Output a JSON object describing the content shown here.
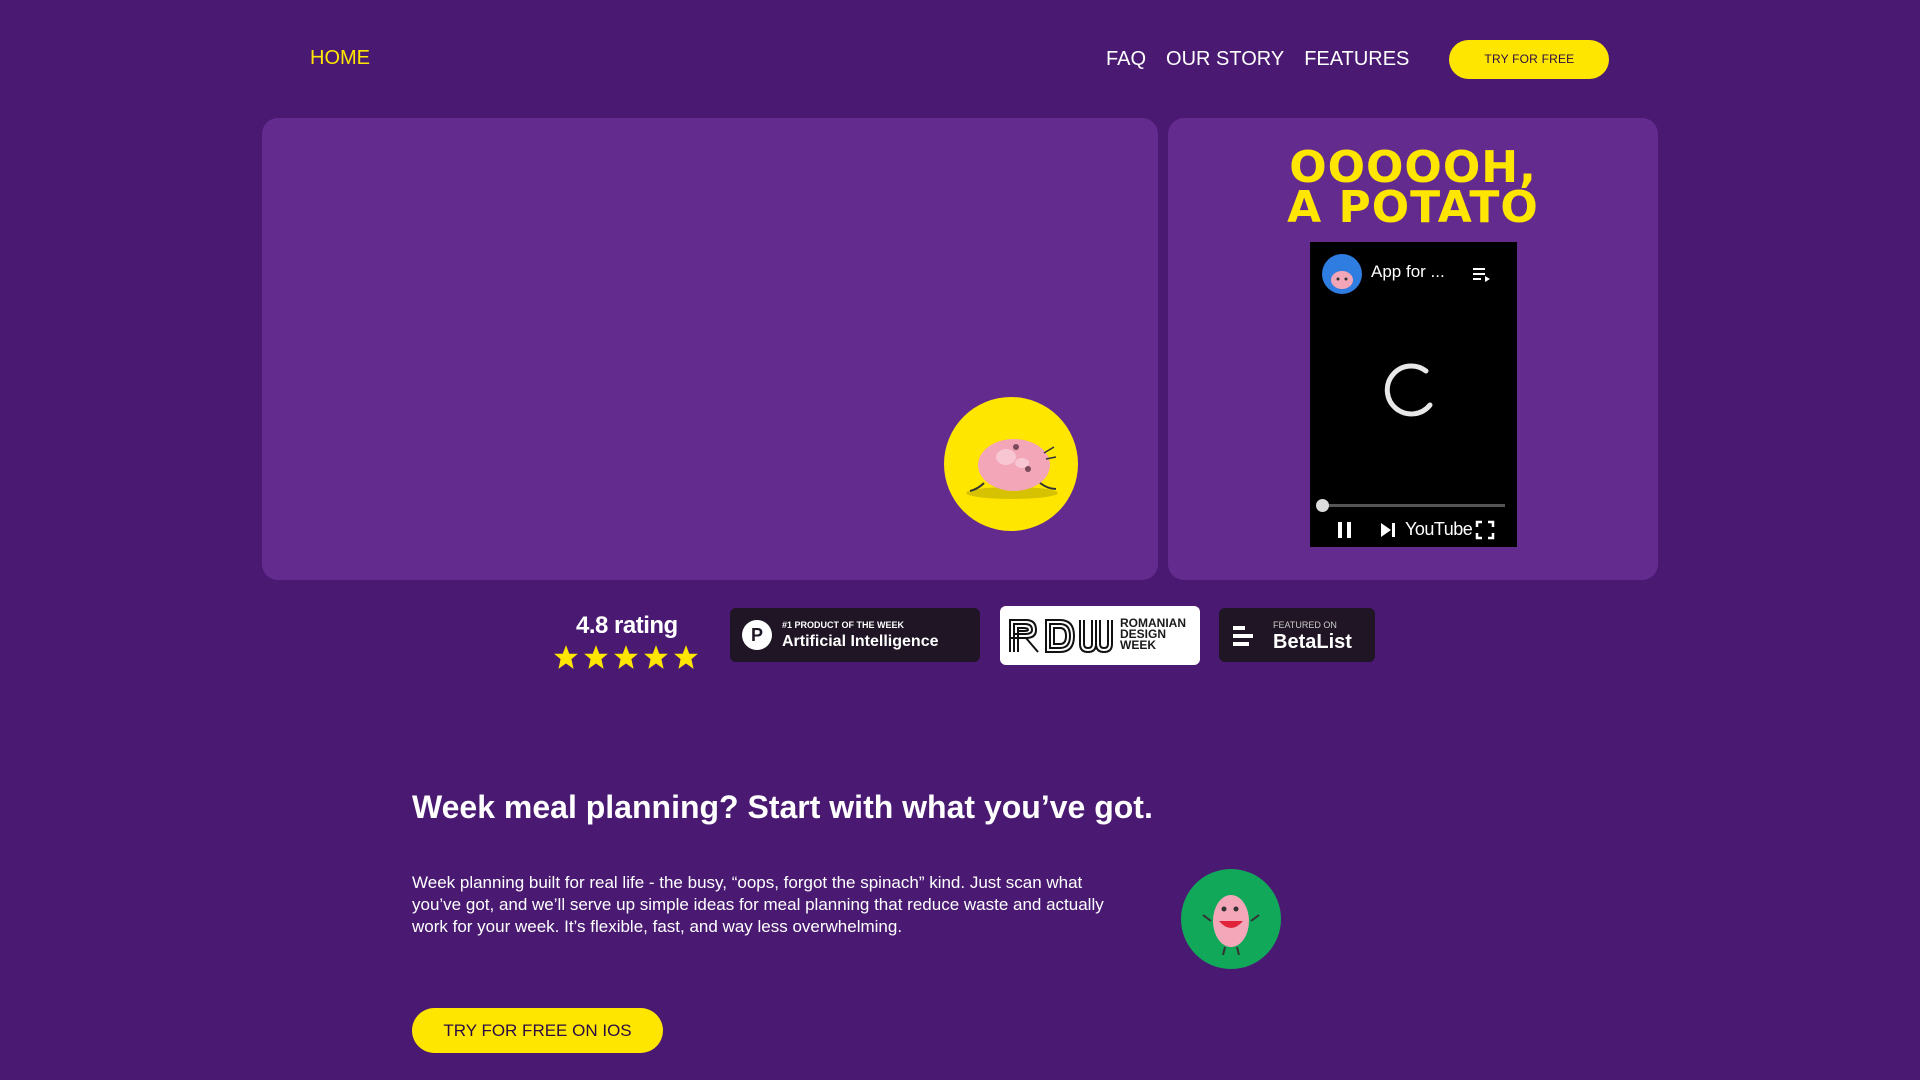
{
  "nav": {
    "home": "HOME",
    "links": [
      "FAQ",
      "OUR STORY",
      "FEATURES"
    ],
    "cta": "TRY FOR FREE"
  },
  "hero": {
    "headline_line1": "OOOOOH,",
    "headline_line2": "A POTATO",
    "video": {
      "title": "App for ...",
      "platform": "YouTube",
      "progress": 0.0
    }
  },
  "badges": {
    "rating": "4.8 rating",
    "stars": 5,
    "product_hunt_small": "#1 PRODUCT OF THE WEEK",
    "product_hunt_big": "Artificial Intelligence",
    "product_hunt_logo": "P",
    "rdw_logo": "RDW",
    "rdw_lines": [
      "ROMANIAN",
      "DESIGN",
      "WEEK"
    ],
    "betalist_small": "FEATURED ON",
    "betalist_big": "BetaList"
  },
  "section": {
    "title": "Week meal planning? Start with what you’ve got.",
    "body": "Week planning built for real life - the busy, “oops, forgot the spinach” kind. Just scan what you’ve got, and we’ll serve up simple ideas for meal planning that reduce waste and actually work for your week. It’s flexible, fast, and way less overwhelming.",
    "cta": "TRY FOR FREE ON IOS"
  },
  "colors": {
    "background": "#4a1a72",
    "panel": "#642b8f",
    "accent": "#ffe600",
    "badge_dark": "#1f1524",
    "green": "#11a85a"
  }
}
